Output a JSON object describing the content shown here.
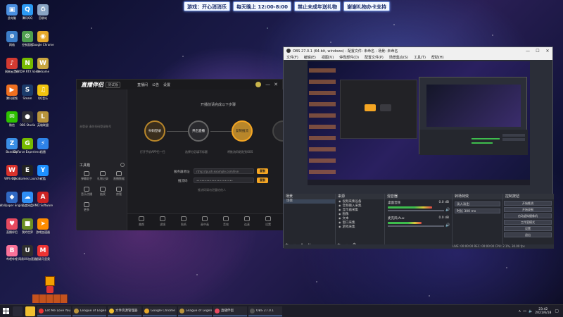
{
  "banner": {
    "items": [
      "游戏：开心消消乐",
      "每天晚上 12:00-8:00",
      "禁止未成年送礼物",
      "谢谢礼物办卡支持"
    ]
  },
  "desktop": {
    "icons": [
      {
        "label": "此电脑",
        "color": "#4a8fe0",
        "glyph": "▣"
      },
      {
        "label": "腾讯QQ",
        "color": "#2b9af3",
        "glyph": "Q"
      },
      {
        "label": "回收站",
        "color": "#8aa5c5",
        "glyph": "♻"
      },
      {
        "label": "网络",
        "color": "#3c7ec9",
        "glyph": "⊕"
      },
      {
        "label": "控制面板",
        "color": "#4e9e4e",
        "glyph": "⚙"
      },
      {
        "label": "Google Chrome",
        "color": "#e5a82b",
        "glyph": "◉"
      },
      {
        "label": "网易云音乐",
        "color": "#d33a31",
        "glyph": "♪"
      },
      {
        "label": "NVIDIA RTX Voice",
        "color": "#76b900",
        "glyph": "N"
      },
      {
        "label": "WeGame",
        "color": "#c9a640",
        "glyph": "W"
      },
      {
        "label": "腾讯视频",
        "color": "#f07020",
        "glyph": "▶"
      },
      {
        "label": "Steam",
        "color": "#1b3b6a",
        "glyph": "S"
      },
      {
        "label": "QQ音乐",
        "color": "#f1c40f",
        "glyph": "♫"
      },
      {
        "label": "微信",
        "color": "#2dc100",
        "glyph": "✉"
      },
      {
        "label": "OBS Studio",
        "color": "#2d2d35",
        "glyph": "●"
      },
      {
        "label": "英雄联盟",
        "color": "#b8943c",
        "glyph": "L"
      },
      {
        "label": "Bandizip",
        "color": "#3a8ee6",
        "glyph": "Z"
      },
      {
        "label": "GeForce Experience",
        "color": "#76b900",
        "glyph": "G"
      },
      {
        "label": "迅雷",
        "color": "#2e83e8",
        "glyph": "⚡"
      },
      {
        "label": "WPS Office",
        "color": "#d9322c",
        "glyph": "W"
      },
      {
        "label": "Epic Games Launcher",
        "color": "#222",
        "glyph": "E"
      },
      {
        "label": "优酷",
        "color": "#1e90ff",
        "glyph": "Y"
      },
      {
        "label": "Wallpaper Engine",
        "color": "#3069c3",
        "glyph": "◆"
      },
      {
        "label": "百度网盘",
        "color": "#2f8ef4",
        "glyph": "☁"
      },
      {
        "label": "AMD Software",
        "color": "#c22",
        "glyph": "A"
      },
      {
        "label": "直播伴侣",
        "color": "#e84a5f",
        "glyph": "♥"
      },
      {
        "label": "我的世界",
        "color": "#6b8e23",
        "glyph": "■"
      },
      {
        "label": "游戏加速器",
        "color": "#ff8c00",
        "glyph": "➤"
      },
      {
        "label": "哔哩哔哩",
        "color": "#fb7299",
        "glyph": "B"
      },
      {
        "label": "网易UU加速器",
        "color": "#2f2f2f",
        "glyph": "U"
      },
      {
        "label": "超级马里奥",
        "color": "#e33",
        "glyph": "M"
      }
    ]
  },
  "live": {
    "logo": "直播伴侣",
    "version": "测试版",
    "top_tabs": [
      "直播间",
      "公告",
      "设置"
    ],
    "sidebar_hint": "未登录 请先扫码登录账号",
    "sidebar_section": "工具箱",
    "tools": [
      "弹幕助手",
      "礼物记录",
      "直播数据",
      "音乐点播",
      "抽奖",
      "房管",
      "更多"
    ],
    "steps": [
      "扫码登录",
      "开启直播",
      "复制推流"
    ],
    "step_captions": [
      "打开手机APP扫一扫",
      "选择分区填写标题",
      "将推流码粘贴到OBS"
    ],
    "header_text": "开播前请完成以下步骤",
    "server_label": "服务器地址",
    "key_label": "推流码",
    "copy_btn": "复制",
    "server_value": "rtmp://push.example.com/live",
    "key_value": "••••••••••••••••••••••",
    "footer_hint": "推流码请勿泄露给他人",
    "bottom_tools": [
      "美颜",
      "滤镜",
      "贴纸",
      "画中画",
      "音效",
      "连麦",
      "设置"
    ]
  },
  "obs": {
    "title": "OBS 27.0.1 (64-bit, windows) - 配置文件: 未命名 - 场景: 未命名",
    "menu": [
      "文件(F)",
      "编辑(E)",
      "视图(V)",
      "停靠部件(D)",
      "配置文件(P)",
      "场景集合(S)",
      "工具(T)",
      "帮助(H)"
    ],
    "window_controls": [
      "—",
      "☐",
      "✕"
    ],
    "docks": {
      "scenes": {
        "title": "场景",
        "items": [
          "场景"
        ]
      },
      "sources": {
        "title": "来源",
        "items": [
          "视频采集设备",
          "音频输入采集",
          "显示器采集",
          "图像",
          "文本",
          "窗口采集",
          "游戏采集"
        ]
      },
      "mixer": {
        "title": "混音器",
        "channels": [
          {
            "name": "桌面音频",
            "value": "0.0 dB",
            "level": 0.72
          },
          {
            "name": "麦克风/Aux",
            "value": "0.0 dB",
            "level": 0.55
          }
        ]
      },
      "transitions": {
        "title": "转场特效",
        "items": [
          "淡入淡出",
          "时长 300 ms"
        ]
      },
      "controls": {
        "title": "控制按钮",
        "buttons": [
          "开始推流",
          "开始录制",
          "启动虚拟摄像机",
          "工作室模式",
          "设置",
          "退出"
        ]
      }
    },
    "status": "LIVE: 00:00:00  REC: 00:00:00  CPU: 2.1%, 30.00 fps"
  },
  "taskbar": {
    "tasks": [
      {
        "title": "Let Me Love You",
        "color": "#e33"
      },
      {
        "title": "League of Legends",
        "color": "#b8943c"
      },
      {
        "title": "文件资源管理器",
        "color": "#f0c030"
      },
      {
        "title": "Google Chrome",
        "color": "#e5a82b"
      },
      {
        "title": "League of Legends",
        "color": "#b8943c"
      },
      {
        "title": "直播伴侣",
        "color": "#e84a5f"
      },
      {
        "title": "OBS 27.0.1",
        "color": "#555"
      }
    ],
    "time": "23:42",
    "date": "2021/6/18"
  }
}
